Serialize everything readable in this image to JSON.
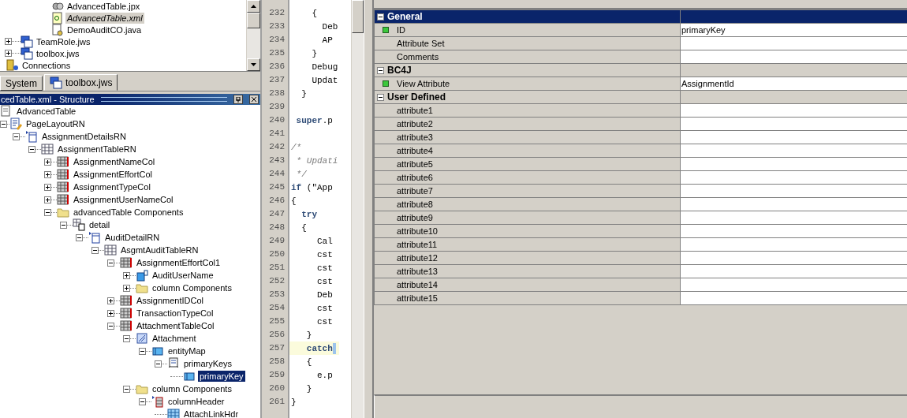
{
  "navigator": {
    "items": [
      {
        "label": "AdvancedTable.jpx",
        "kind": "project-file",
        "selected": false
      },
      {
        "label": "AdvancedTable.xml",
        "kind": "xml-file",
        "selected": true
      },
      {
        "label": "DemoAuditCO.java",
        "kind": "java-file",
        "selected": false
      },
      {
        "label": "TeamRole.jws",
        "kind": "workspace",
        "expanded": false,
        "selected": false
      },
      {
        "label": "toolbox.jws",
        "kind": "workspace",
        "expanded": false,
        "selected": false
      },
      {
        "label": "Connections",
        "kind": "connections",
        "selected": false
      }
    ]
  },
  "tabs": [
    {
      "label": "System",
      "selected": false
    },
    {
      "label": "toolbox.jws",
      "selected": true
    }
  ],
  "structure": {
    "title": "cedTable.xml - Structure",
    "tree": [
      {
        "label": "AdvancedTable",
        "kind": "page-def",
        "selected": false,
        "children": [
          {
            "label": "PageLayoutRN",
            "kind": "page-layout",
            "expanded": true,
            "selected": false,
            "children": [
              {
                "label": "AssignmentDetailsRN",
                "kind": "region",
                "expanded": true,
                "selected": false,
                "children": [
                  {
                    "label": "AssignmentTableRN",
                    "kind": "table",
                    "expanded": true,
                    "selected": false,
                    "children": [
                      {
                        "label": "AssignmentNameCol",
                        "kind": "column",
                        "expanded": false,
                        "selected": false
                      },
                      {
                        "label": "AssignmentEffortCol",
                        "kind": "column",
                        "expanded": false,
                        "selected": false
                      },
                      {
                        "label": "AssignmentTypeCol",
                        "kind": "column",
                        "expanded": false,
                        "selected": false
                      },
                      {
                        "label": "AssignmentUserNameCol",
                        "kind": "column",
                        "expanded": false,
                        "selected": false
                      },
                      {
                        "label": "advancedTable Components",
                        "kind": "folder",
                        "expanded": true,
                        "selected": false,
                        "children": [
                          {
                            "label": "detail",
                            "kind": "detail",
                            "expanded": true,
                            "selected": false,
                            "children": [
                              {
                                "label": "AuditDetailRN",
                                "kind": "region",
                                "expanded": true,
                                "selected": false,
                                "children": [
                                  {
                                    "label": "AsgmtAuditTableRN",
                                    "kind": "table",
                                    "expanded": true,
                                    "selected": false,
                                    "children": [
                                      {
                                        "label": "AssignmentEffortCol1",
                                        "kind": "column",
                                        "expanded": true,
                                        "selected": false,
                                        "children": [
                                          {
                                            "label": "AuditUserName",
                                            "kind": "item",
                                            "expanded": false,
                                            "selected": false
                                          },
                                          {
                                            "label": "column Components",
                                            "kind": "folder",
                                            "expanded": false,
                                            "selected": false
                                          }
                                        ]
                                      },
                                      {
                                        "label": "AssignmentIDCol",
                                        "kind": "column",
                                        "expanded": false,
                                        "selected": false
                                      },
                                      {
                                        "label": "TransactionTypeCol",
                                        "kind": "column",
                                        "expanded": false,
                                        "selected": false
                                      },
                                      {
                                        "label": "AttachmentTableCol",
                                        "kind": "column",
                                        "expanded": true,
                                        "selected": false,
                                        "children": [
                                          {
                                            "label": "Attachment",
                                            "kind": "attachment",
                                            "expanded": true,
                                            "selected": false,
                                            "children": [
                                              {
                                                "label": "entityMap",
                                                "kind": "entity-map",
                                                "expanded": true,
                                                "selected": false,
                                                "children": [
                                                  {
                                                    "label": "primaryKeys",
                                                    "kind": "keys",
                                                    "expanded": true,
                                                    "selected": false,
                                                    "children": [
                                                      {
                                                        "label": "primaryKey",
                                                        "kind": "entity-map",
                                                        "selected": true
                                                      }
                                                    ]
                                                  }
                                                ]
                                              }
                                            ]
                                          },
                                          {
                                            "label": "column Components",
                                            "kind": "folder",
                                            "expanded": true,
                                            "selected": false,
                                            "children": [
                                              {
                                                "label": "columnHeader",
                                                "kind": "column-header",
                                                "expanded": true,
                                                "selected": false,
                                                "children": [
                                                  {
                                                    "label": "AttachLinkHdr",
                                                    "kind": "link-table",
                                                    "selected": false
                                                  }
                                                ]
                                              }
                                            ]
                                          }
                                        ]
                                      }
                                    ]
                                  }
                                ]
                              }
                            ]
                          }
                        ]
                      }
                    ]
                  }
                ]
              }
            ]
          }
        ]
      }
    ]
  },
  "code": {
    "lines": [
      {
        "number": "232",
        "text": "    {",
        "kind": "plain",
        "current": false
      },
      {
        "number": "233",
        "text": "      Deb",
        "kind": "plain",
        "current": false
      },
      {
        "number": "234",
        "text": "      AP",
        "kind": "plain",
        "current": false
      },
      {
        "number": "235",
        "text": "    }",
        "kind": "plain",
        "current": false
      },
      {
        "number": "236",
        "text": "    Debug",
        "kind": "plain",
        "current": false
      },
      {
        "number": "237",
        "text": "    Updat",
        "kind": "plain",
        "current": false
      },
      {
        "number": "238",
        "text": "  }",
        "kind": "plain",
        "current": false
      },
      {
        "number": "239",
        "kind": "plain",
        "current": false
      },
      {
        "number": "240",
        "text": " **super**.p",
        "kind": "plain",
        "current": false
      },
      {
        "number": "241",
        "kind": "plain",
        "current": false
      },
      {
        "number": "242",
        "text": "/*",
        "kind": "comment",
        "current": false
      },
      {
        "number": "243",
        "text": " * Updati",
        "kind": "comment",
        "current": false
      },
      {
        "number": "244",
        "text": " */",
        "kind": "comment",
        "current": false
      },
      {
        "number": "245",
        "text": "**if** (\"App",
        "kind": "plain",
        "current": false
      },
      {
        "number": "246",
        "text": "{",
        "kind": "plain",
        "current": false
      },
      {
        "number": "247",
        "text": "  **try**",
        "kind": "plain",
        "current": false
      },
      {
        "number": "248",
        "text": "  {",
        "kind": "plain",
        "current": false
      },
      {
        "number": "249",
        "text": "     Cal",
        "kind": "plain",
        "current": false
      },
      {
        "number": "250",
        "text": "     cst",
        "kind": "plain",
        "current": false
      },
      {
        "number": "251",
        "text": "     cst",
        "kind": "plain",
        "current": false
      },
      {
        "number": "252",
        "text": "     cst",
        "kind": "plain",
        "current": false
      },
      {
        "number": "253",
        "text": "     Deb",
        "kind": "plain",
        "current": false
      },
      {
        "number": "254",
        "text": "     cst",
        "kind": "plain",
        "current": false
      },
      {
        "number": "255",
        "text": "     cst",
        "kind": "plain",
        "current": false
      },
      {
        "number": "256",
        "text": "   }",
        "kind": "plain",
        "current": false
      },
      {
        "number": "257",
        "text": "   **catch**",
        "kind": "plain",
        "current": true
      },
      {
        "number": "258",
        "text": "   {",
        "kind": "plain",
        "current": false
      },
      {
        "number": "259",
        "text": "     e.p",
        "kind": "plain",
        "current": false
      },
      {
        "number": "260",
        "text": "   }",
        "kind": "plain",
        "current": false
      },
      {
        "number": "261",
        "text": "}",
        "kind": "plain",
        "current": false
      }
    ]
  },
  "properties": {
    "sections": [
      {
        "name": "General",
        "expanded": true,
        "selected": true,
        "rows": [
          {
            "name": "ID",
            "value": "primaryKey",
            "set": true
          },
          {
            "name": "Attribute Set",
            "set": false
          },
          {
            "name": "Comments",
            "set": false
          }
        ]
      },
      {
        "name": "BC4J",
        "expanded": true,
        "selected": false,
        "rows": [
          {
            "name": "View Attribute",
            "value": "AssignmentId",
            "set": true
          }
        ]
      },
      {
        "name": "User Defined",
        "expanded": true,
        "selected": false,
        "rows": [
          {
            "name": "attribute1",
            "set": false
          },
          {
            "name": "attribute2",
            "set": false
          },
          {
            "name": "attribute3",
            "set": false
          },
          {
            "name": "attribute4",
            "set": false
          },
          {
            "name": "attribute5",
            "set": false
          },
          {
            "name": "attribute6",
            "set": false
          },
          {
            "name": "attribute7",
            "set": false
          },
          {
            "name": "attribute8",
            "set": false
          },
          {
            "name": "attribute9",
            "set": false
          },
          {
            "name": "attribute10",
            "set": false
          },
          {
            "name": "attribute11",
            "set": false
          },
          {
            "name": "attribute12",
            "set": false
          },
          {
            "name": "attribute13",
            "set": false
          },
          {
            "name": "attribute14",
            "set": false
          },
          {
            "name": "attribute15",
            "set": false
          }
        ]
      }
    ]
  }
}
